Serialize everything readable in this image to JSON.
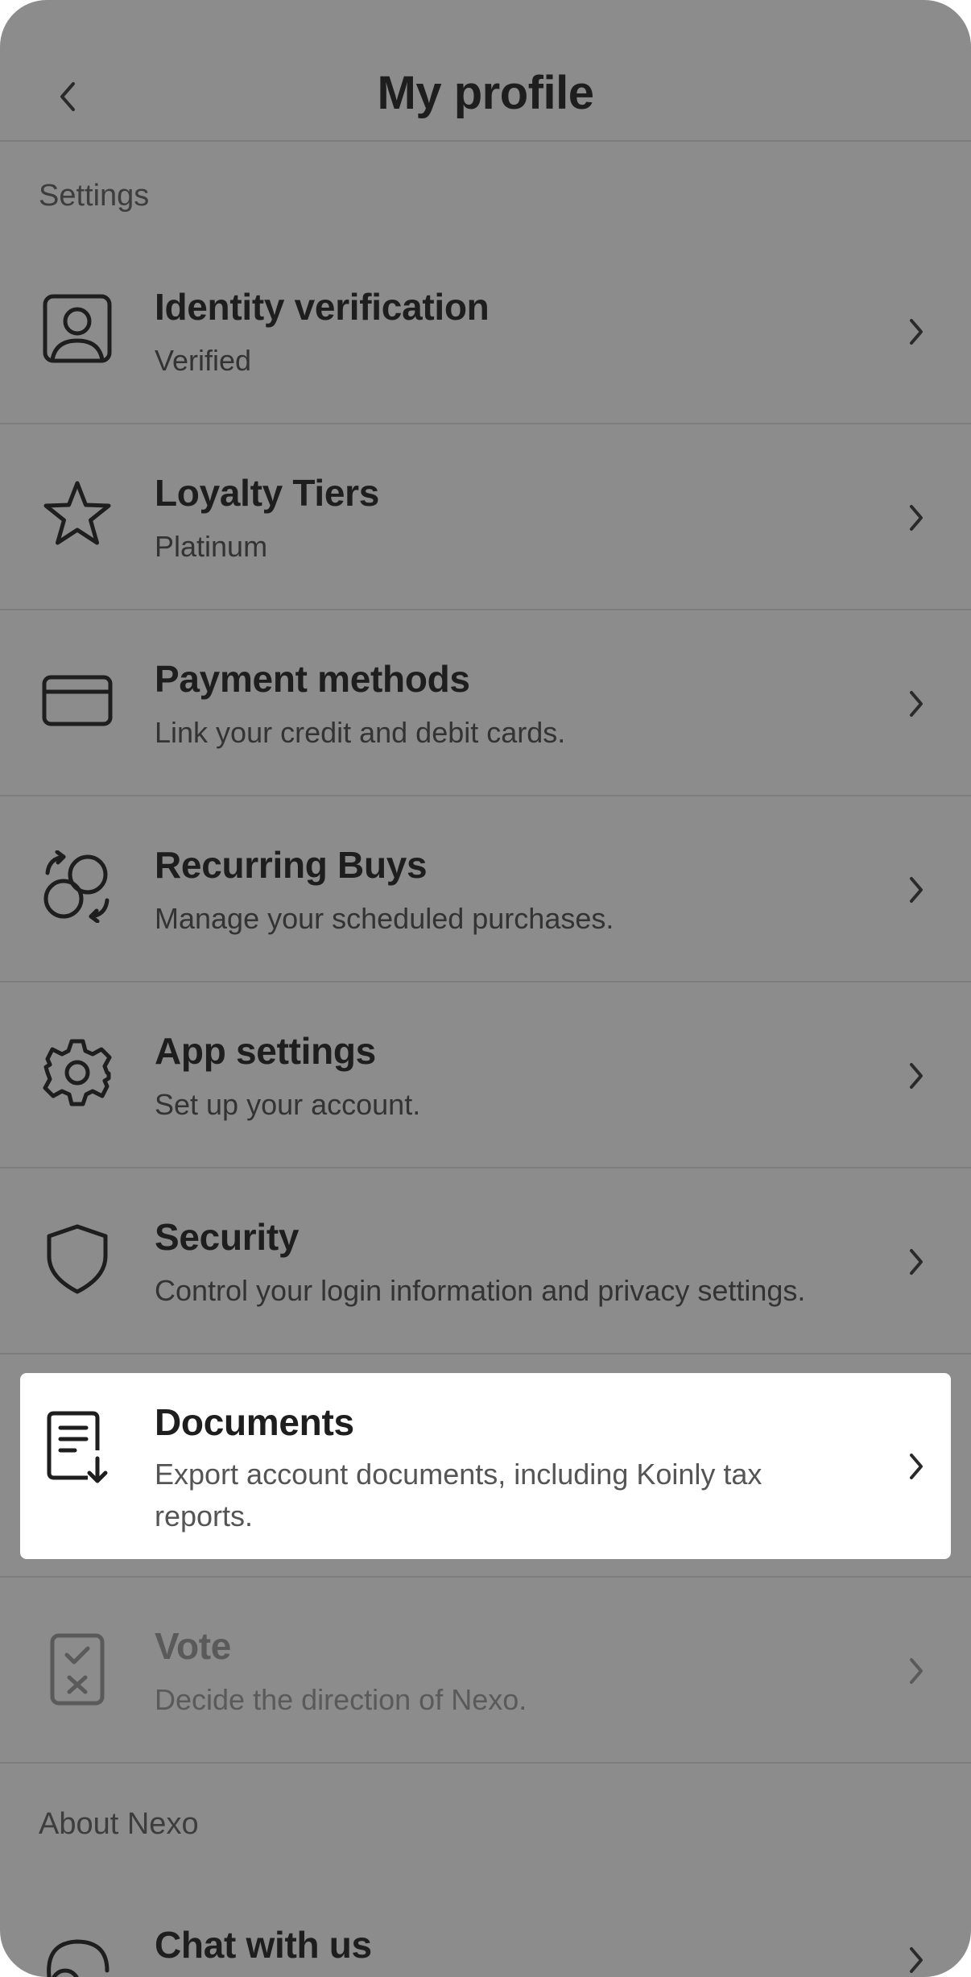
{
  "header": {
    "title": "My profile"
  },
  "sections": {
    "settings": "Settings",
    "about": "About Nexo"
  },
  "items": [
    {
      "title": "Identity verification",
      "subtitle": "Verified",
      "icon": "identity-icon"
    },
    {
      "title": "Loyalty Tiers",
      "subtitle": "Platinum",
      "icon": "star-icon"
    },
    {
      "title": "Payment methods",
      "subtitle": "Link your credit and debit cards.",
      "icon": "card-icon"
    },
    {
      "title": "Recurring Buys",
      "subtitle": "Manage your scheduled purchases.",
      "icon": "recurring-icon"
    },
    {
      "title": "App settings",
      "subtitle": "Set up your account.",
      "icon": "gear-icon"
    },
    {
      "title": "Security",
      "subtitle": "Control your login information and privacy settings.",
      "icon": "shield-icon"
    },
    {
      "title": "Documents",
      "subtitle": "Export account documents, including Koinly tax reports.",
      "icon": "document-download-icon"
    },
    {
      "title": "Vote",
      "subtitle": "Decide the direction of Nexo.",
      "icon": "vote-icon"
    }
  ],
  "about_items": [
    {
      "title": "Chat with us",
      "icon": "chat-icon"
    }
  ],
  "colors": {
    "overlay": "#8c8c8c",
    "highlight": "#ffffff",
    "text": "#1e1e1e"
  }
}
